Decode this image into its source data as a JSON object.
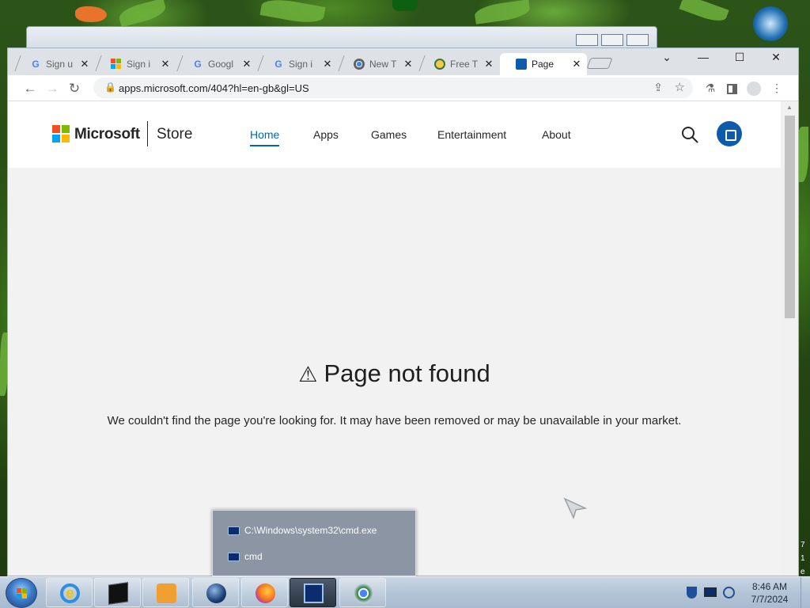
{
  "browser": {
    "tabs": [
      {
        "title": "Sign u",
        "favicon": "google-icon",
        "active": false
      },
      {
        "title": "Sign i",
        "favicon": "microsoft-icon",
        "active": false
      },
      {
        "title": "Googl",
        "favicon": "google-icon",
        "active": false
      },
      {
        "title": "Sign i",
        "favicon": "google-icon",
        "active": false
      },
      {
        "title": "New T",
        "favicon": "chrome-icon",
        "active": false
      },
      {
        "title": "Free T",
        "favicon": "tool-icon",
        "active": false
      },
      {
        "title": "Page",
        "favicon": "store-icon",
        "active": true
      }
    ],
    "tab_close_glyph": "✕",
    "window_controls": {
      "minimize": "—",
      "maximize": "☐",
      "close": "✕",
      "chevron": "⌄"
    },
    "url": "apps.microsoft.com/404?hl=en-gb&gl=US"
  },
  "store": {
    "brand": "Microsoft",
    "product": "Store",
    "nav": [
      {
        "label": "Home",
        "active": true
      },
      {
        "label": "Apps",
        "active": false
      },
      {
        "label": "Games",
        "active": false
      },
      {
        "label": "Entertainment",
        "active": false
      },
      {
        "label": "About",
        "active": false
      }
    ],
    "error_title": "Page not found",
    "error_message": "We couldn't find the page you're looking for. It may have been removed or may be unavailable in your market."
  },
  "taskbar": {
    "popup_items": [
      {
        "label": "C:\\Windows\\system32\\cmd.exe"
      },
      {
        "label": "cmd"
      }
    ],
    "time": "8:46 AM",
    "date": "7/7/2024",
    "edge_glyphs": [
      "7",
      "1",
      "e"
    ]
  },
  "colors": {
    "ms_red": "#f25022",
    "ms_green": "#7fba00",
    "ms_blue": "#00a4ef",
    "ms_yellow": "#ffb900",
    "store_accent": "#0067b8"
  }
}
